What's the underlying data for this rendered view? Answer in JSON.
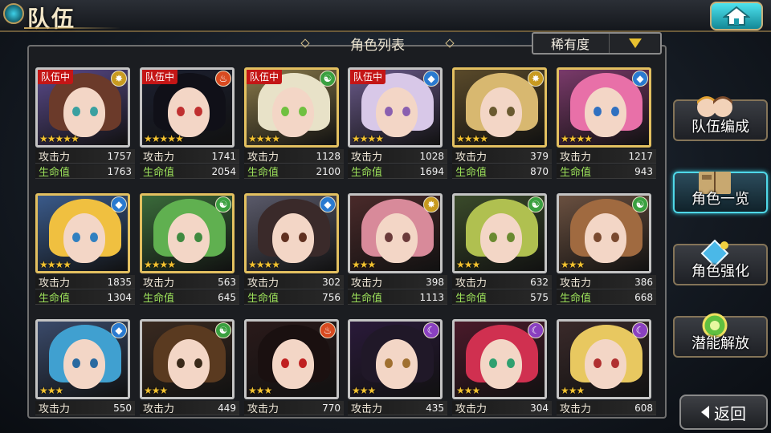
{
  "header": {
    "title": "队伍"
  },
  "panel": {
    "title": "角色列表",
    "sort_label": "稀有度"
  },
  "labels": {
    "atk": "攻击力",
    "hp": "生命值",
    "team_tag": "队伍中"
  },
  "side_menu": [
    {
      "label": "队伍编成",
      "icon": "party-portraits-icon"
    },
    {
      "label": "角色一览",
      "icon": "book-icon",
      "active": true
    },
    {
      "label": "角色强化",
      "icon": "enhance-crystal-icon"
    },
    {
      "label": "潜能解放",
      "icon": "potential-orb-icon"
    }
  ],
  "back_label": "返回",
  "colors": {
    "team_tag": "#c41616",
    "atk_label": "#f0e8d8",
    "hp_label": "#9ce05a",
    "star_on": "#f3c230",
    "active_border": "#4fd8e8"
  },
  "characters": [
    {
      "in_team": true,
      "element": "light",
      "stars": 5,
      "atk": "1757",
      "hp": "1763",
      "frame": "silver",
      "bg": "#5a4a8a",
      "hair": "#6b3a2a",
      "eye": "#3aa0a0"
    },
    {
      "in_team": true,
      "element": "fire",
      "stars": 5,
      "atk": "1741",
      "hp": "2054",
      "frame": "silver",
      "bg": "#1c2030",
      "hair": "#101018",
      "eye": "#c03030"
    },
    {
      "in_team": true,
      "element": "wind",
      "stars": 4,
      "atk": "1128",
      "hp": "2100",
      "frame": "gold",
      "bg": "#8a7a4a",
      "hair": "#e8e2c8",
      "eye": "#70c040"
    },
    {
      "in_team": true,
      "element": "water",
      "stars": 4,
      "atk": "1028",
      "hp": "1694",
      "frame": "silver",
      "bg": "#6a5a8a",
      "hair": "#d8c8e8",
      "eye": "#8a60b0"
    },
    {
      "in_team": false,
      "element": "light",
      "stars": 4,
      "atk": "379",
      "hp": "870",
      "frame": "gold",
      "bg": "#5a4a2a",
      "hair": "#d8b870",
      "eye": "#6a5a30"
    },
    {
      "in_team": false,
      "element": "water",
      "stars": 4,
      "atk": "1217",
      "hp": "943",
      "frame": "gold",
      "bg": "#7a3a6a",
      "hair": "#e870a8",
      "eye": "#3070c0"
    },
    {
      "in_team": false,
      "element": "water",
      "stars": 4,
      "atk": "1835",
      "hp": "1304",
      "frame": "gold",
      "bg": "#3a5a8a",
      "hair": "#f0c040",
      "eye": "#3080c0"
    },
    {
      "in_team": false,
      "element": "wind",
      "stars": 4,
      "atk": "563",
      "hp": "645",
      "frame": "gold",
      "bg": "#3a6a3a",
      "hair": "#60b050",
      "eye": "#408a40"
    },
    {
      "in_team": false,
      "element": "water",
      "stars": 4,
      "atk": "302",
      "hp": "756",
      "frame": "gold",
      "bg": "#5a5a6a",
      "hair": "#3a2a2a",
      "eye": "#603020"
    },
    {
      "in_team": false,
      "element": "light",
      "stars": 3,
      "atk": "398",
      "hp": "1113",
      "frame": "silver",
      "bg": "#4a2a2a",
      "hair": "#d88a9a",
      "eye": "#6a3a3a"
    },
    {
      "in_team": false,
      "element": "wind",
      "stars": 3,
      "atk": "632",
      "hp": "575",
      "frame": "silver",
      "bg": "#3a4a2a",
      "hair": "#b0c050",
      "eye": "#6a8a30"
    },
    {
      "in_team": false,
      "element": "wind",
      "stars": 3,
      "atk": "386",
      "hp": "668",
      "frame": "silver",
      "bg": "#6a5040",
      "hair": "#a06a40",
      "eye": "#7a4a30"
    },
    {
      "in_team": false,
      "element": "water",
      "stars": 3,
      "atk": "550",
      "hp": "",
      "frame": "silver",
      "bg": "#3a4a6a",
      "hair": "#40a0d0",
      "eye": "#2a6aa0"
    },
    {
      "in_team": false,
      "element": "wind",
      "stars": 3,
      "atk": "449",
      "hp": "",
      "frame": "silver",
      "bg": "#3a2a20",
      "hair": "#5a3a20",
      "eye": "#3a2a1a"
    },
    {
      "in_team": false,
      "element": "fire",
      "stars": 3,
      "atk": "770",
      "hp": "",
      "frame": "silver",
      "bg": "#2a1a1a",
      "hair": "#1a1010",
      "eye": "#c02020"
    },
    {
      "in_team": false,
      "element": "dark",
      "stars": 3,
      "atk": "435",
      "hp": "",
      "frame": "silver",
      "bg": "#2a1a3a",
      "hair": "#201828",
      "eye": "#a07030"
    },
    {
      "in_team": false,
      "element": "dark",
      "stars": 3,
      "atk": "304",
      "hp": "",
      "frame": "silver",
      "bg": "#4a1a2a",
      "hair": "#d03050",
      "eye": "#30a070"
    },
    {
      "in_team": false,
      "element": "dark",
      "stars": 3,
      "atk": "608",
      "hp": "",
      "frame": "silver",
      "bg": "#3a2a2a",
      "hair": "#e8c860",
      "eye": "#b03030"
    }
  ]
}
